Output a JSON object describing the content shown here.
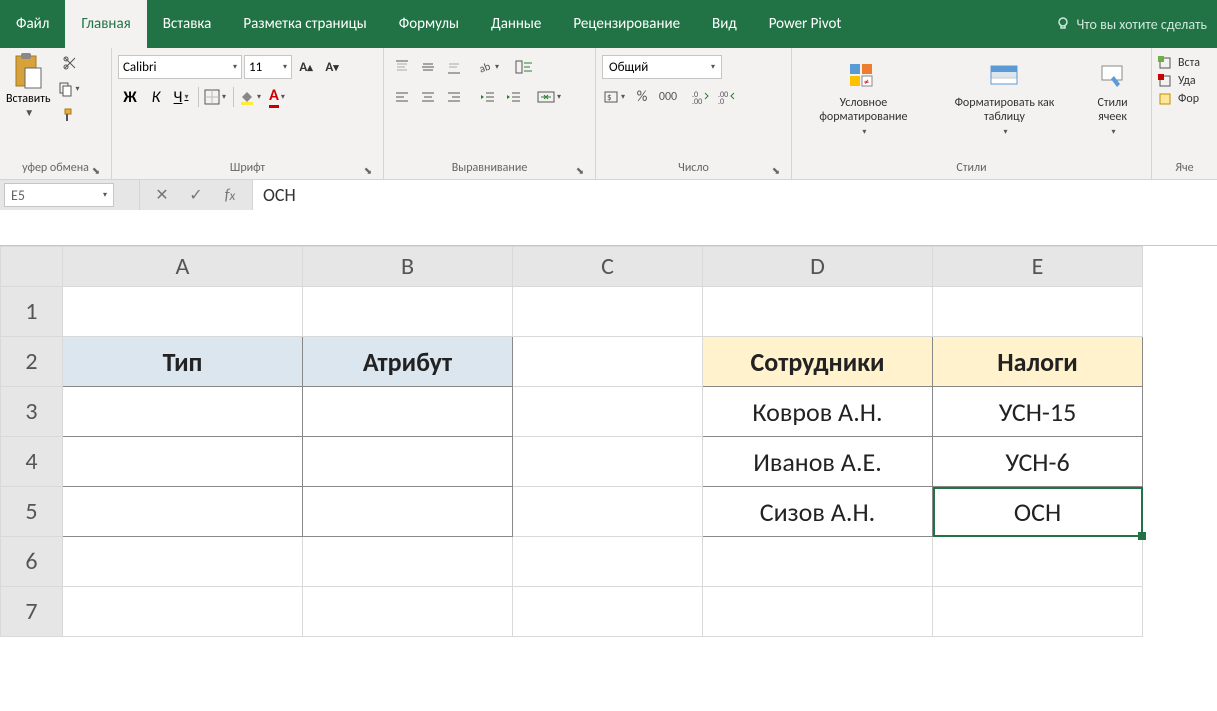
{
  "tabs": {
    "file": "Файл",
    "home": "Главная",
    "insert": "Вставка",
    "page_layout": "Разметка страницы",
    "formulas": "Формулы",
    "data": "Данные",
    "review": "Рецензирование",
    "view": "Вид",
    "power_pivot": "Power Pivot",
    "tell_me": "Что вы хотите сделать"
  },
  "ribbon": {
    "clipboard": {
      "paste": "Вставить",
      "label": "уфер обмена"
    },
    "font": {
      "name": "Calibri",
      "size": "11",
      "bold": "Ж",
      "italic": "К",
      "underline": "Ч",
      "label": "Шрифт"
    },
    "alignment": {
      "label": "Выравнивание"
    },
    "number": {
      "format": "Общий",
      "label": "Число"
    },
    "styles": {
      "cond_fmt": "Условное форматирование",
      "as_table": "Форматировать как таблицу",
      "cell_styles": "Стили ячеек",
      "label": "Стили"
    },
    "cells": {
      "insert": "Вста",
      "delete": "Уда",
      "format": "Фор",
      "label": "Яче"
    }
  },
  "formula_bar": {
    "name_box": "E5",
    "value": "ОСН"
  },
  "grid": {
    "cols": [
      "A",
      "B",
      "C",
      "D",
      "E"
    ],
    "rows": [
      "1",
      "2",
      "3",
      "4",
      "5",
      "6",
      "7"
    ],
    "table1_headers": {
      "A2": "Тип",
      "B2": "Атрибут"
    },
    "table2_headers": {
      "D2": "Сотрудники",
      "E2": "Налоги"
    },
    "table2": {
      "D3": "Ковров А.Н.",
      "E3": "УСН-15",
      "D4": "Иванов А.Е.",
      "E4": "УСН-6",
      "D5": "Сизов А.Н.",
      "E5": "ОСН"
    }
  }
}
